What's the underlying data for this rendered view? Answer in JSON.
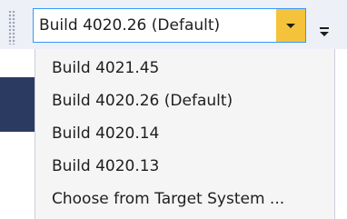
{
  "combo": {
    "selected_value": "Build 4020.26 (Default)"
  },
  "menu": {
    "items": [
      {
        "label": "Build 4021.45"
      },
      {
        "label": "Build 4020.26 (Default)"
      },
      {
        "label": "Build 4020.14"
      },
      {
        "label": "Build 4020.13"
      },
      {
        "label": "Choose from Target System ..."
      }
    ]
  },
  "colors": {
    "accent_border": "#3399ff",
    "dropdown_button": "#f5c33b",
    "toolbar_bg": "#eef0f7",
    "menu_bg": "#f5f5f5"
  },
  "icons": {
    "grip": "toolbar-grip-icon",
    "dropdown": "chevron-down-icon",
    "overflow": "toolbar-overflow-icon"
  }
}
